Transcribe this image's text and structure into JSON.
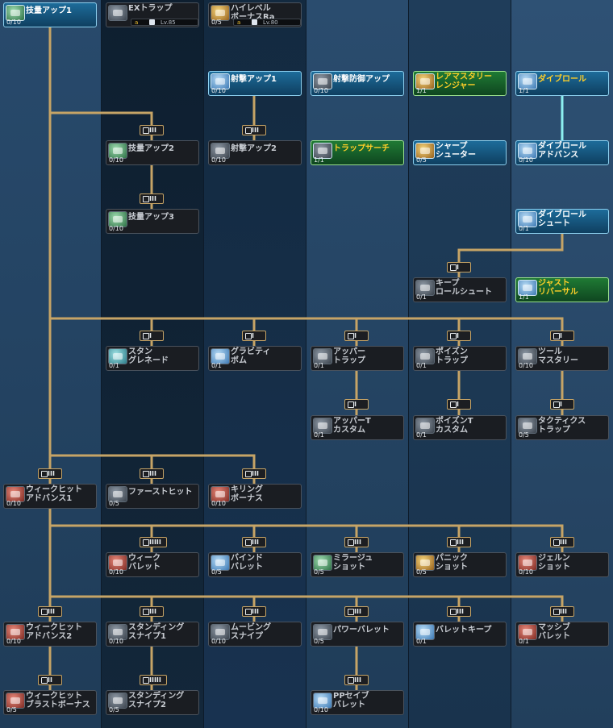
{
  "colors": {
    "line": "#c6a466",
    "highlight_line": "#8df0f0",
    "active": "#1d6c9a",
    "special": "#1f7a34"
  },
  "badges": {
    "b_i": "I",
    "b_ii": "II",
    "b_iii": "III",
    "b_iiiii": "IIIII"
  },
  "reqs": [
    {
      "lock": "a",
      "level": "Lv.85"
    },
    {
      "lock": "a",
      "level": "Lv.80"
    }
  ],
  "skills": [
    {
      "name": "技量アップ1",
      "level": "0/10",
      "icon": "skill-up-icon"
    },
    {
      "name": "EXトラップ",
      "level": "",
      "icon": "ex-trap-icon"
    },
    {
      "name": "ハイレベル\nボーナスRa",
      "level": "0/5",
      "icon": "high-level-bonus-icon"
    },
    {
      "name": "射撃アップ1",
      "level": "0/10",
      "icon": "shooting-up-icon"
    },
    {
      "name": "射撃防御アップ",
      "level": "0/10",
      "icon": "shooting-defense-icon"
    },
    {
      "name": "レアマスタリー\nレンジャー",
      "level": "1/1",
      "icon": "rare-mastery-icon"
    },
    {
      "name": "ダイブロール",
      "level": "1/1",
      "icon": "dive-roll-icon"
    },
    {
      "name": "技量アップ2",
      "level": "0/10",
      "icon": "skill-up-icon"
    },
    {
      "name": "射撃アップ2",
      "level": "0/10",
      "icon": "shooting-up-icon"
    },
    {
      "name": "トラップサーチ",
      "level": "1/1",
      "icon": "trap-search-icon"
    },
    {
      "name": "シャープ\nシューター",
      "level": "0/5",
      "icon": "sharp-shooter-icon"
    },
    {
      "name": "ダイブロール\nアドバンス",
      "level": "0/10",
      "icon": "dive-roll-icon"
    },
    {
      "name": "技量アップ3",
      "level": "0/10",
      "icon": "skill-up-icon"
    },
    {
      "name": "ダイブロール\nシュート",
      "level": "0/1",
      "icon": "dive-roll-icon"
    },
    {
      "name": "キープ\nロールシュート",
      "level": "0/1",
      "icon": "keep-roll-shoot-icon"
    },
    {
      "name": "ジャスト\nリバーサル",
      "level": "1/1",
      "icon": "just-reversal-icon"
    },
    {
      "name": "スタン\nグレネード",
      "level": "0/1",
      "icon": "stun-grenade-icon"
    },
    {
      "name": "グラビティ\nボム",
      "level": "0/1",
      "icon": "gravity-bomb-icon"
    },
    {
      "name": "アッパー\nトラップ",
      "level": "0/1",
      "icon": "upper-trap-icon"
    },
    {
      "name": "ポイズン\nトラップ",
      "level": "0/1",
      "icon": "poison-trap-icon"
    },
    {
      "name": "ツール\nマスタリー",
      "level": "0/10",
      "icon": "tool-mastery-icon"
    },
    {
      "name": "アッパーT\nカスタム",
      "level": "0/1",
      "icon": "upper-trap-icon"
    },
    {
      "name": "ポイズンT\nカスタム",
      "level": "0/1",
      "icon": "poison-trap-icon"
    },
    {
      "name": "タクティクス\nトラップ",
      "level": "0/5",
      "icon": "tactics-trap-icon"
    },
    {
      "name": "ウィークヒット\nアドバンス1",
      "level": "0/10",
      "icon": "weak-hit-icon"
    },
    {
      "name": "ファーストヒット",
      "level": "0/5",
      "icon": "first-hit-icon"
    },
    {
      "name": "キリング\nボーナス",
      "level": "0/10",
      "icon": "killing-bonus-icon"
    },
    {
      "name": "ウィーク\nバレット",
      "level": "0/10",
      "icon": "weak-bullet-icon"
    },
    {
      "name": "バインド\nバレット",
      "level": "0/5",
      "icon": "bind-bullet-icon"
    },
    {
      "name": "ミラージュ\nショット",
      "level": "0/5",
      "icon": "mirage-shot-icon"
    },
    {
      "name": "パニック\nショット",
      "level": "0/5",
      "icon": "panic-shot-icon"
    },
    {
      "name": "ジェルン\nショット",
      "level": "0/10",
      "icon": "jellen-shot-icon"
    },
    {
      "name": "ウィークヒット\nアドバンス2",
      "level": "0/10",
      "icon": "weak-hit-icon"
    },
    {
      "name": "スタンディング\nスナイプ1",
      "level": "0/10",
      "icon": "standing-snipe-icon"
    },
    {
      "name": "ムービング\nスナイプ",
      "level": "0/10",
      "icon": "moving-snipe-icon"
    },
    {
      "name": "パワーバレット",
      "level": "0/5",
      "icon": "power-bullet-icon"
    },
    {
      "name": "バレットキープ",
      "level": "0/1",
      "icon": "bullet-keep-icon"
    },
    {
      "name": "マッシブ\nバレット",
      "level": "0/1",
      "icon": "massive-bullet-icon"
    },
    {
      "name": "ウィークヒット\nブラストボーナス",
      "level": "0/5",
      "icon": "weak-hit-icon"
    },
    {
      "name": "スタンディング\nスナイプ2",
      "level": "0/5",
      "icon": "standing-snipe-icon"
    },
    {
      "name": "PPセイブ\nバレット",
      "level": "0/10",
      "icon": "pp-save-bullet-icon"
    }
  ]
}
